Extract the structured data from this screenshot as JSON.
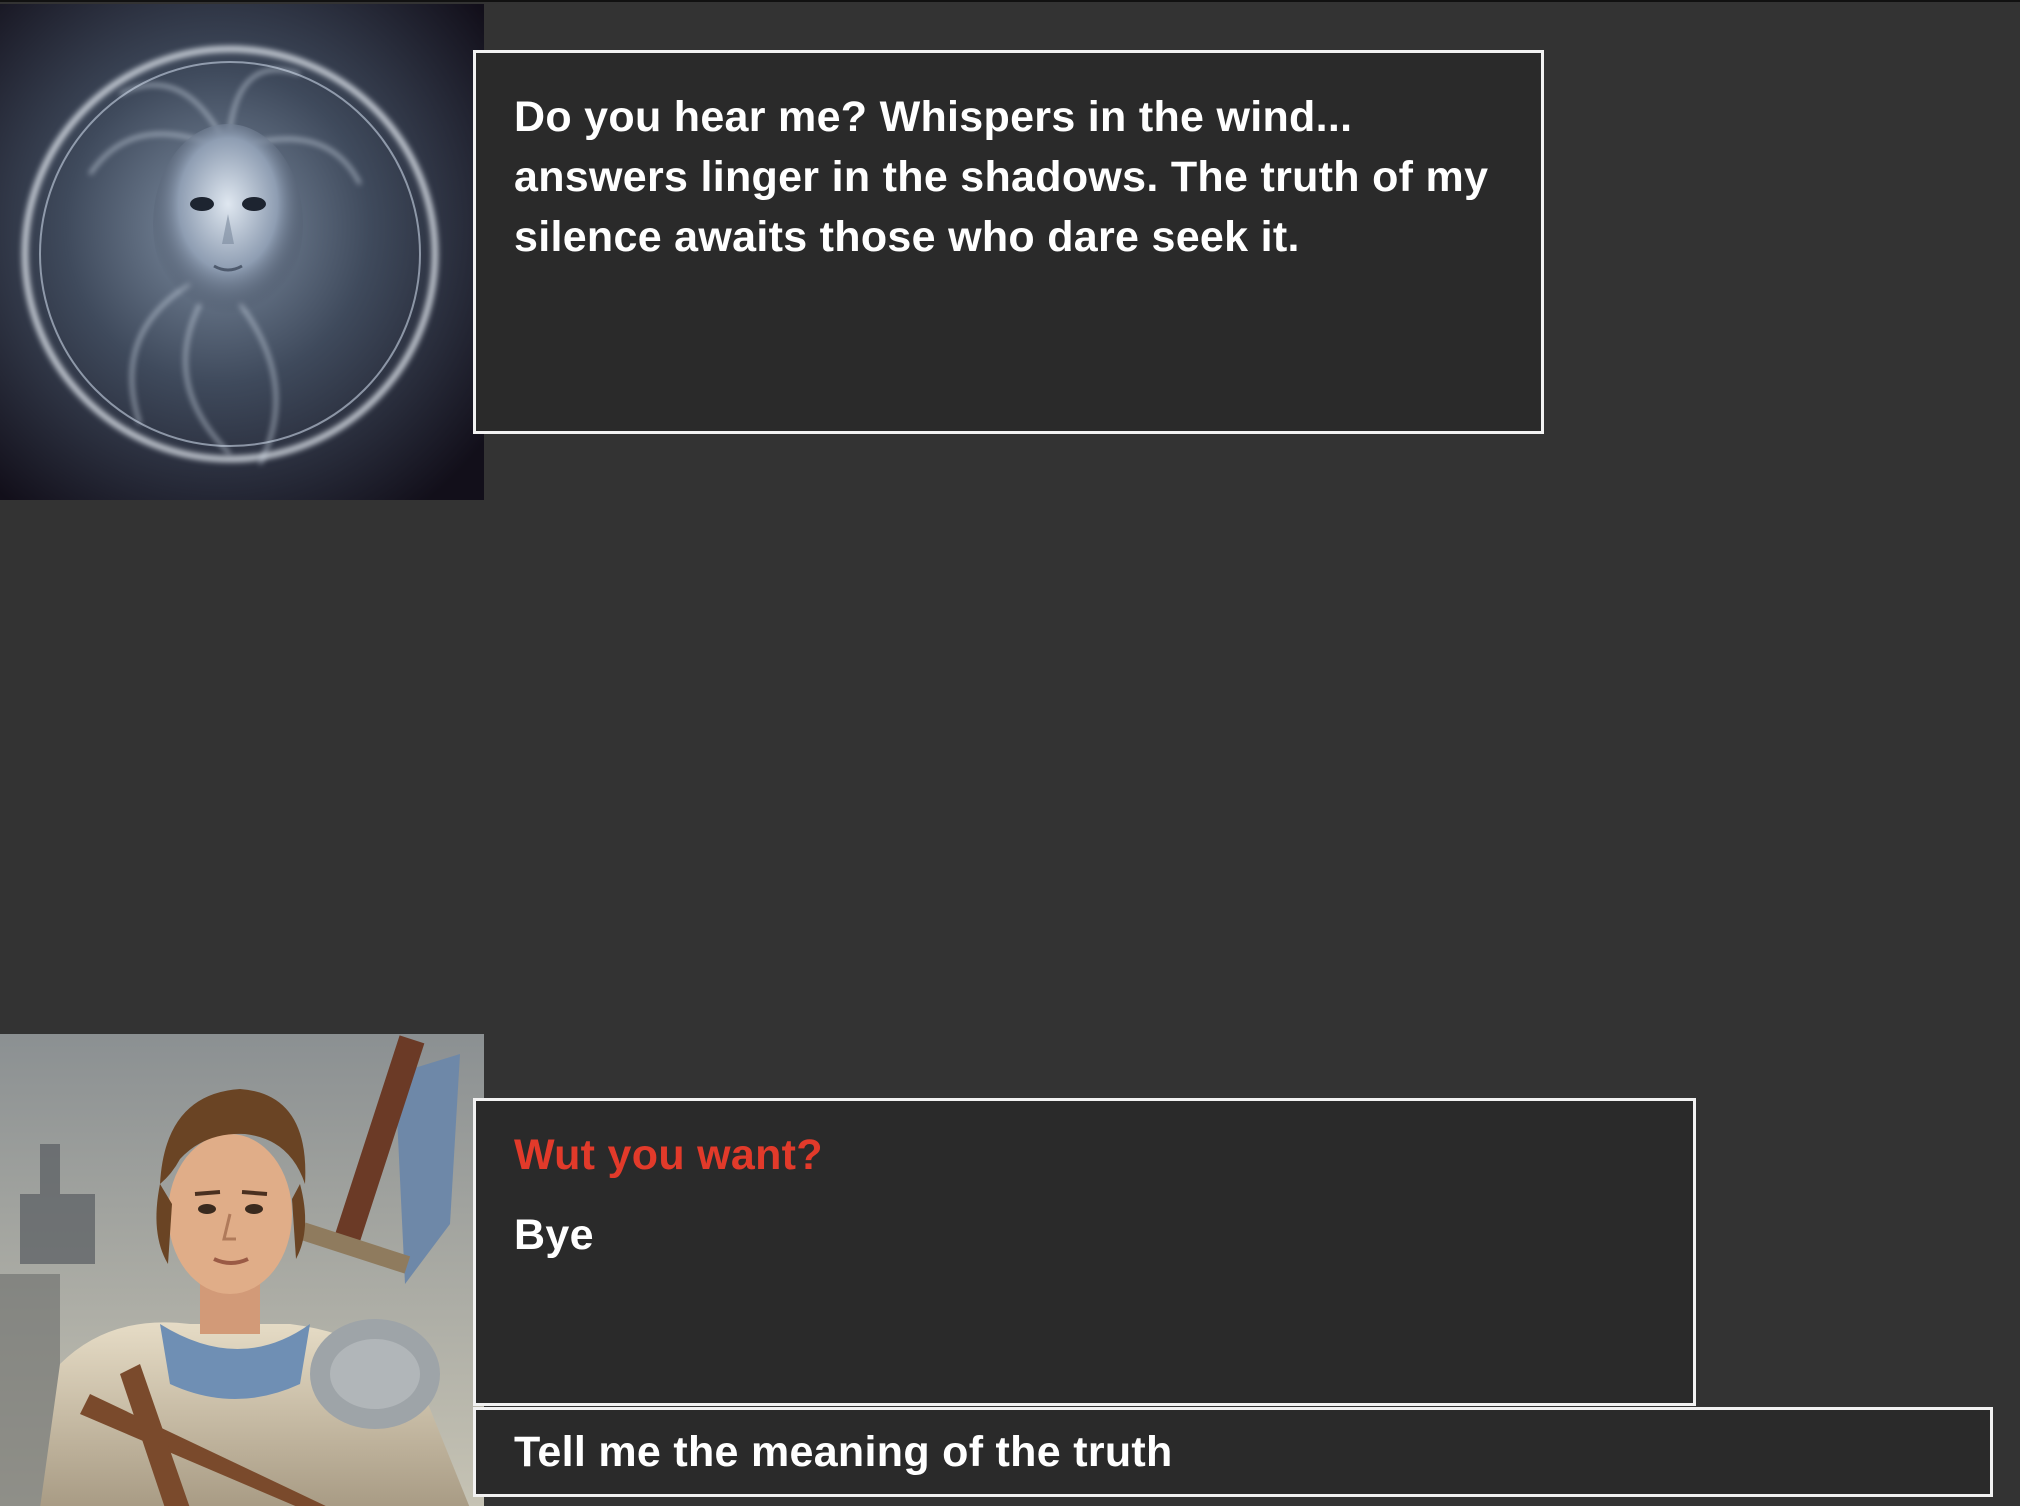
{
  "npc": {
    "portrait_icon": "spirit-portrait",
    "dialogue": "Do you hear me? Whispers in the wind... answers linger in the shadows. The truth of my silence awaits those who dare seek it."
  },
  "player": {
    "portrait_icon": "adventurer-portrait",
    "options": [
      {
        "label": "Wut you want?",
        "state": "selected"
      },
      {
        "label": "Bye",
        "state": "normal"
      }
    ],
    "input_text": "Tell me the meaning of the truth"
  },
  "colors": {
    "background": "#333333",
    "panel": "#2a2a2a",
    "border": "#f2f2f2",
    "highlight": "#e23a2a",
    "text": "#ffffff"
  }
}
